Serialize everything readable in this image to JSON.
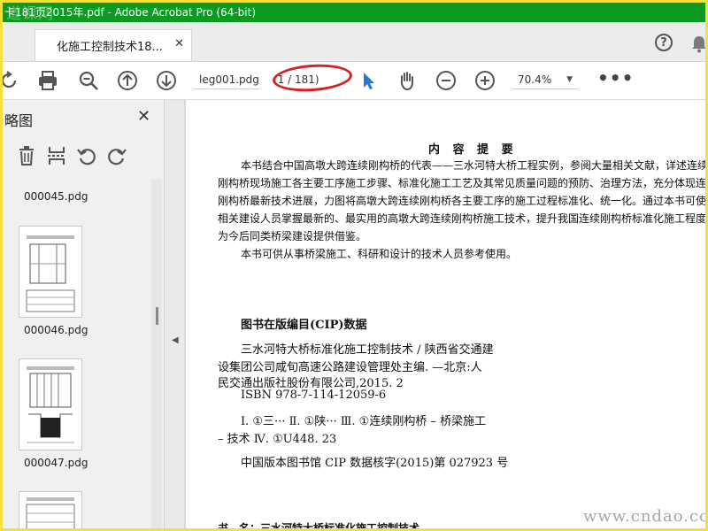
{
  "window": {
    "title": "卡181页2015年.pdf - Adobe Acrobat Pro (64-bit)",
    "watermark": "道课网"
  },
  "tabs": [
    {
      "label": "化施工控制技术18...",
      "close": "✕"
    }
  ],
  "header_icons": {
    "help": "?",
    "bell": "bell-icon"
  },
  "toolbar": {
    "doc_name": "leg001.pdg",
    "page_indicator": "(1 / 181)",
    "zoom": "70.4%",
    "more": "•••",
    "icons": [
      "rotate-icon",
      "print-icon",
      "zoom-out-magnifier-icon",
      "page-up-icon",
      "page-down-icon",
      "select-cursor-icon",
      "hand-icon",
      "zoom-out-icon",
      "zoom-in-icon"
    ]
  },
  "left_panel": {
    "title": "略图",
    "close": "✕",
    "tools": [
      "delete-icon",
      "extract-icon",
      "undo-rotate-icon",
      "redo-rotate-icon"
    ],
    "thumbnails": [
      {
        "label": "000045.pdg"
      },
      {
        "label": "000046.pdg"
      },
      {
        "label": "000047.pdg"
      }
    ]
  },
  "document": {
    "heading": "内 容 提 要",
    "summary_lines": [
      "本书结合中国高墩大跨连续刚构桥的代表——三水河特大桥工程实例，参阅大量相关文献，详述连续",
      "刚构桥现场施工各主要工序施工步骤、标准化施工工艺及其常见质量问题的预防、治理方法，充分体现连续",
      "刚构桥最新技术进展，力图将高墩大跨连续刚构桥各主要工序的施工过程标准化、统一化。通过本书可使",
      "相关建设人员掌握最新的、最实用的高墩大跨连续刚构桥施工技术，提升我国连续刚构桥标准化施工程度，",
      "为今后同类桥梁建设提供借鉴。",
      "本书可供从事桥梁施工、科研和设计的技术人员参考使用。"
    ],
    "cip_heading": "图书在版编目(CIP)数据",
    "cip_lines": [
      "三水河特大桥标准化施工控制技术 / 陕西省交通建",
      "设集团公司咸旬高速公路建设管理处主编. —北京:人",
      "民交通出版社股份有限公司,2015. 2",
      "ISBN 978-7-114-12059-6",
      "Ⅰ. ①三··· Ⅱ. ①陕··· Ⅲ. ①连续刚构桥 – 桥梁施工",
      "– 技术 Ⅳ. ①U448. 23",
      "中国版本图书馆 CIP 数据核字(2015)第 027923 号"
    ],
    "footer_line": "书　名：三水河特大桥标准化施工控制技术"
  },
  "page_watermark": "www.cndao.com"
}
